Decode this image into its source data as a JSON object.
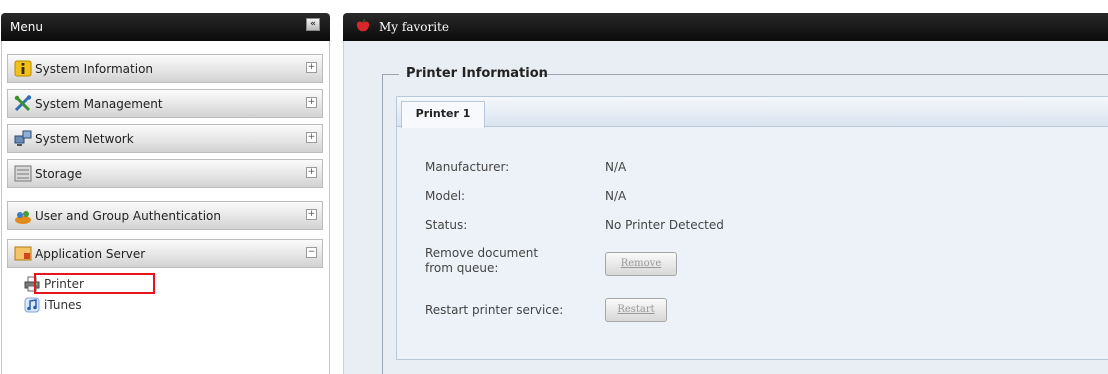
{
  "menu": {
    "title": "Menu",
    "collapse_symbol": "«",
    "categories": [
      {
        "label": "System Information",
        "icon": "info-icon",
        "toggle": "+"
      },
      {
        "label": "System Management",
        "icon": "tools-icon",
        "toggle": "+"
      },
      {
        "label": "System Network",
        "icon": "network-icon",
        "toggle": "+"
      },
      {
        "label": "Storage",
        "icon": "storage-icon",
        "toggle": "+"
      },
      {
        "label": "User and Group Authentication",
        "icon": "users-icon",
        "toggle": "+"
      },
      {
        "label": "Application Server",
        "icon": "app-server-icon",
        "toggle": "−"
      }
    ],
    "sub_items": [
      {
        "label": "Printer",
        "icon": "printer-icon",
        "highlighted": true
      },
      {
        "label": "iTunes",
        "icon": "itunes-icon",
        "highlighted": false
      }
    ]
  },
  "header": {
    "favorite_title": "My favorite",
    "favorite_icon": "apple-icon"
  },
  "printer_info": {
    "legend": "Printer Information",
    "tab_label": "Printer 1",
    "fields": {
      "manufacturer_label": "Manufacturer:",
      "manufacturer_value": "N/A",
      "model_label": "Model:",
      "model_value": "N/A",
      "status_label": "Status:",
      "status_value": "No Printer Detected",
      "remove_label_line1": "Remove document",
      "remove_label_line2": "from queue:",
      "restart_label": "Restart printer service:"
    },
    "buttons": {
      "remove": "Remove",
      "restart": "Restart"
    }
  },
  "colors": {
    "header_bg": "#111111",
    "highlight_border": "#e8141d",
    "content_bg": "#e9eef4"
  }
}
